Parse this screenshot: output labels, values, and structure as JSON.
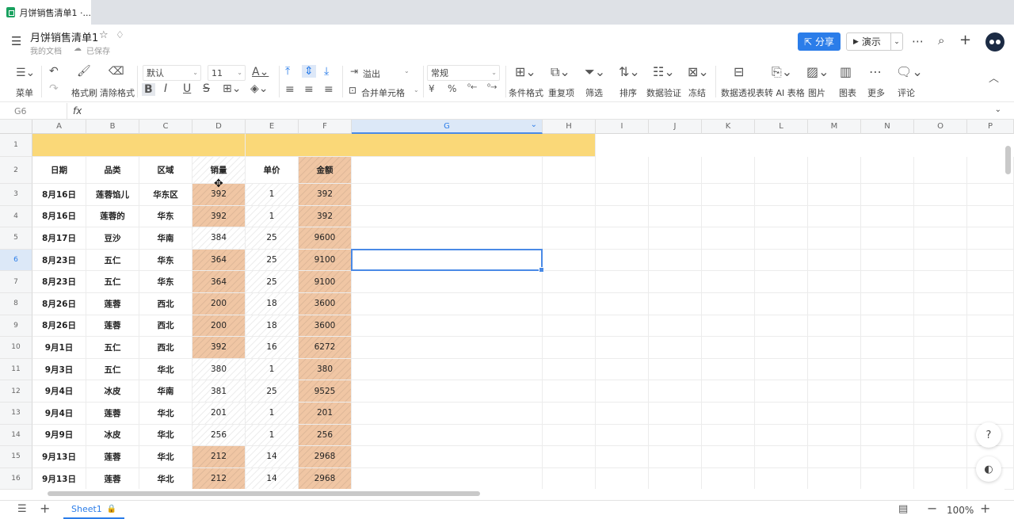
{
  "browser": {
    "tab_title": "月饼销售清单1 ·..."
  },
  "header": {
    "title": "月饼销售清单1",
    "breadcrumb": "我的文档",
    "save_status": "已保存",
    "share_label": "分享",
    "present_label": "演示"
  },
  "toolbar": {
    "menu": "菜单",
    "format_painter": "格式刷",
    "clear_format": "清除格式",
    "font": "默认",
    "font_size": "11",
    "overflow": "溢出",
    "merge_cells": "合并单元格",
    "number_format": "常规",
    "currency_symbol": "¥",
    "percent_symbol": "%",
    "conditional_format": "条件格式",
    "duplicates": "重复项",
    "filter": "筛选",
    "sort": "排序",
    "data_validation": "数据验证",
    "freeze": "冻结",
    "pivot_table": "数据透视表",
    "to_ai_table": "转 AI 表格",
    "image": "图片",
    "chart": "图表",
    "more": "更多",
    "comment": "评论"
  },
  "formula_bar": {
    "cell_ref": "G6",
    "fx": "fx",
    "value": ""
  },
  "grid": {
    "columns": [
      "A",
      "B",
      "C",
      "D",
      "E",
      "F",
      "G",
      "H",
      "I",
      "J",
      "K",
      "L",
      "M",
      "N",
      "O",
      "P"
    ],
    "active_column": "G",
    "active_row": 6,
    "headers": [
      "日期",
      "品类",
      "区域",
      "销量",
      "单价",
      "金额"
    ],
    "rows": [
      {
        "n": 3,
        "cells": [
          "8月16日",
          "莲蓉馅儿",
          "华东区",
          "392",
          "1",
          "392"
        ],
        "hl_d": true
      },
      {
        "n": 4,
        "cells": [
          "8月16日",
          "莲蓉的",
          "华东",
          "392",
          "1",
          "392"
        ],
        "hl_d": true
      },
      {
        "n": 5,
        "cells": [
          "8月17日",
          "豆沙",
          "华南",
          "384",
          "25",
          "9600"
        ],
        "hl_d": false
      },
      {
        "n": 6,
        "cells": [
          "8月23日",
          "五仁",
          "华东",
          "364",
          "25",
          "9100"
        ],
        "hl_d": true
      },
      {
        "n": 7,
        "cells": [
          "8月23日",
          "五仁",
          "华东",
          "364",
          "25",
          "9100"
        ],
        "hl_d": true
      },
      {
        "n": 8,
        "cells": [
          "8月26日",
          "莲蓉",
          "西北",
          "200",
          "18",
          "3600"
        ],
        "hl_d": true
      },
      {
        "n": 9,
        "cells": [
          "8月26日",
          "莲蓉",
          "西北",
          "200",
          "18",
          "3600"
        ],
        "hl_d": true
      },
      {
        "n": 10,
        "cells": [
          "9月1日",
          "五仁",
          "西北",
          "392",
          "16",
          "6272"
        ],
        "hl_d": true
      },
      {
        "n": 11,
        "cells": [
          "9月3日",
          "五仁",
          "华北",
          "380",
          "1",
          "380"
        ],
        "hl_d": false
      },
      {
        "n": 12,
        "cells": [
          "9月4日",
          "冰皮",
          "华南",
          "381",
          "25",
          "9525"
        ],
        "hl_d": false
      },
      {
        "n": 13,
        "cells": [
          "9月4日",
          "莲蓉",
          "华北",
          "201",
          "1",
          "201"
        ],
        "hl_d": false
      },
      {
        "n": 14,
        "cells": [
          "9月9日",
          "冰皮",
          "华北",
          "256",
          "1",
          "256"
        ],
        "hl_d": false
      },
      {
        "n": 15,
        "cells": [
          "9月13日",
          "莲蓉",
          "华北",
          "212",
          "14",
          "2968"
        ],
        "hl_d": true
      },
      {
        "n": 16,
        "cells": [
          "9月13日",
          "莲蓉",
          "华北",
          "212",
          "14",
          "2968"
        ],
        "hl_d": true
      }
    ]
  },
  "status": {
    "sheet_name": "Sheet1",
    "zoom": "100%"
  },
  "colors": {
    "accent": "#2b7de9",
    "header_fill": "#fad878",
    "highlight": "#f0c6a4"
  }
}
